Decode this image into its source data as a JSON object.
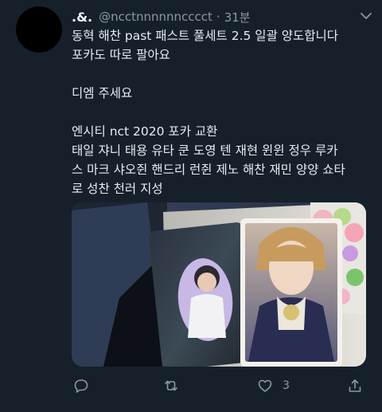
{
  "tweet": {
    "display_name": ".&.",
    "handle": "@ncctnnnnnncccct",
    "separator": "·",
    "time": "31분",
    "body_lines": [
      "동혁 해찬 past 패스트 풀세트 2.5 일괄 양도합니다",
      "포카도 따로 팔아요",
      "",
      " 디엠 주세요",
      "",
      "엔시티 nct 2020 포카 교환",
      "태일 쟈니 태용 유타 쿤 도영 텐 재현 윈윈 정우 루카",
      "스 마크 샤오쥔 핸드리 런쥔 제노 해찬 재민 양양 쇼타",
      "로 성찬 천러 지성"
    ],
    "like_count": "3"
  },
  "colors": {
    "background": "#16202b",
    "secondary_text": "#8899a6",
    "primary_text": "#e7ecf0"
  }
}
